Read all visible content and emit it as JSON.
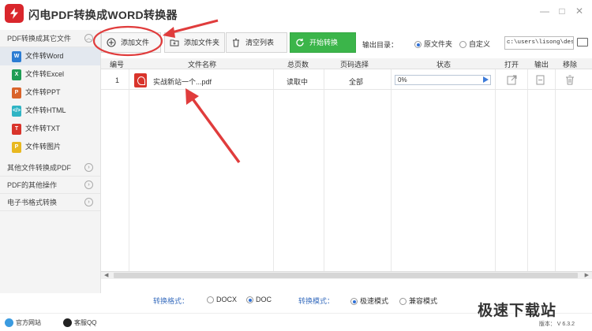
{
  "app": {
    "title": "闪电PDF转换成WORD转换器"
  },
  "window": {
    "min": "—",
    "max": "□",
    "close": "✕"
  },
  "sidebar": {
    "section1": "PDF转换成其它文件",
    "items": [
      {
        "icon": "W",
        "color": "#2b7cd3",
        "label": "文件转Word"
      },
      {
        "icon": "X",
        "color": "#1f9d55",
        "label": "文件转Excel"
      },
      {
        "icon": "P",
        "color": "#d9632a",
        "label": "文件转PPT"
      },
      {
        "icon": "</>",
        "color": "#2fb4c4",
        "label": "文件转HTML"
      },
      {
        "icon": "T",
        "color": "#d9342b",
        "label": "文件转TXT"
      },
      {
        "icon": "P",
        "color": "#e8b820",
        "label": "文件转图片"
      }
    ],
    "section2": "其他文件转换成PDF",
    "section3": "PDF的其他操作",
    "section4": "电子书格式转换"
  },
  "toolbar": {
    "add_file": "添加文件",
    "add_folder": "添加文件夹",
    "clear_list": "清空列表",
    "start": "开始转换",
    "output_dir_label": "输出目录：",
    "opt_source": "原文件夹",
    "opt_custom": "自定义",
    "output_path": "c:\\users\\lisong\\deskto"
  },
  "table": {
    "headers": [
      "编号",
      "文件名称",
      "总页数",
      "页码选择",
      "状态",
      "打开",
      "输出",
      "移除"
    ],
    "rows": [
      {
        "index": "1",
        "filename": "实战新站一个...pdf",
        "pages": "读取中",
        "page_select": "全部",
        "progress": "0%"
      }
    ]
  },
  "bottom": {
    "format_label": "转换格式：",
    "format_docx": "DOCX",
    "format_doc": "DOC",
    "mode_label": "转换模式：",
    "mode_fast": "极速模式",
    "mode_compat": "兼容模式"
  },
  "statusbar": {
    "website": "官方网站",
    "support": "客服QQ",
    "version": "版本： V 6.3.2"
  },
  "watermark": "极速下载站",
  "colors": {
    "accent": "#3bb54a",
    "annotation": "#e03c3c",
    "selected_radio": "#2d6fd6"
  }
}
